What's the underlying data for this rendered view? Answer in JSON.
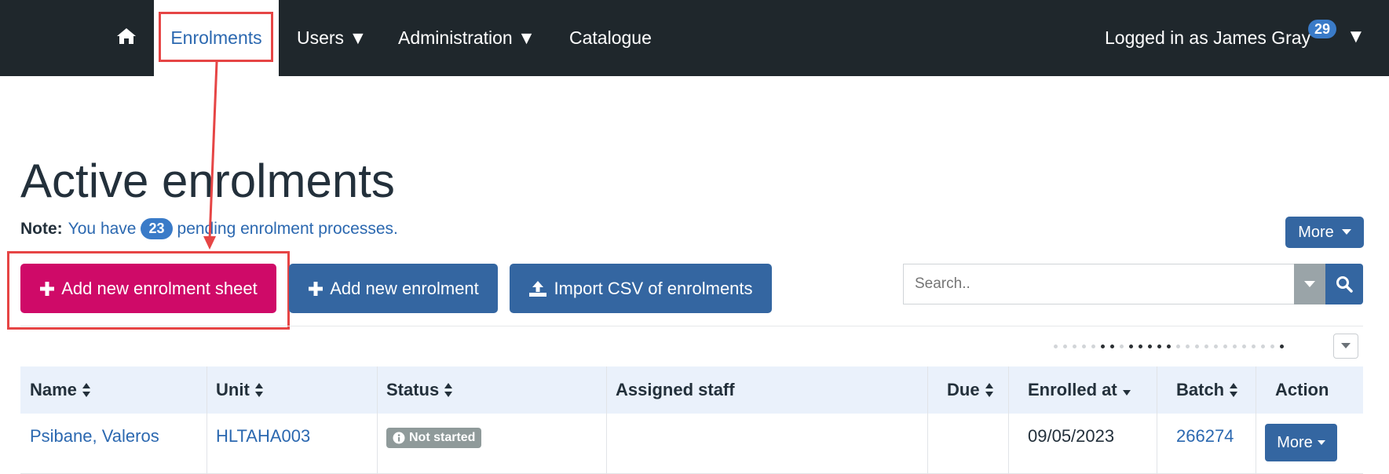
{
  "nav": {
    "home_icon": "home-icon",
    "items": [
      {
        "label": "Enrolments",
        "active": true
      },
      {
        "label": "Users ▼"
      },
      {
        "label": "Administration ▼"
      },
      {
        "label": "Catalogue"
      }
    ],
    "user_label": "Logged in as James Gray",
    "notification_count": "29",
    "user_caret": "▼"
  },
  "page": {
    "title": "Active enrolments",
    "note_label": "Note:",
    "note_prefix": "You have",
    "pending_count": "23",
    "note_suffix": "pending enrolment processes."
  },
  "toolbar": {
    "more_label": "More",
    "add_sheet_label": "Add new enrolment sheet",
    "add_enrolment_label": "Add new enrolment",
    "import_label": "Import CSV of enrolments"
  },
  "search": {
    "placeholder": "Search.."
  },
  "table": {
    "columns": [
      "Name",
      "Unit",
      "Status",
      "Assigned staff",
      "Due",
      "Enrolled at",
      "Batch",
      "Action"
    ],
    "rows": [
      {
        "name": "Psibane, Valeros",
        "unit": "HLTAHA003",
        "status": "Not started",
        "assigned_staff": "",
        "due": "",
        "enrolled_at": "09/05/2023",
        "batch": "266274",
        "action": "More"
      }
    ]
  },
  "colors": {
    "navbar": "#1f272c",
    "primary": "#3466a1",
    "accent": "#cf0a68",
    "annotation": "#e64545"
  }
}
